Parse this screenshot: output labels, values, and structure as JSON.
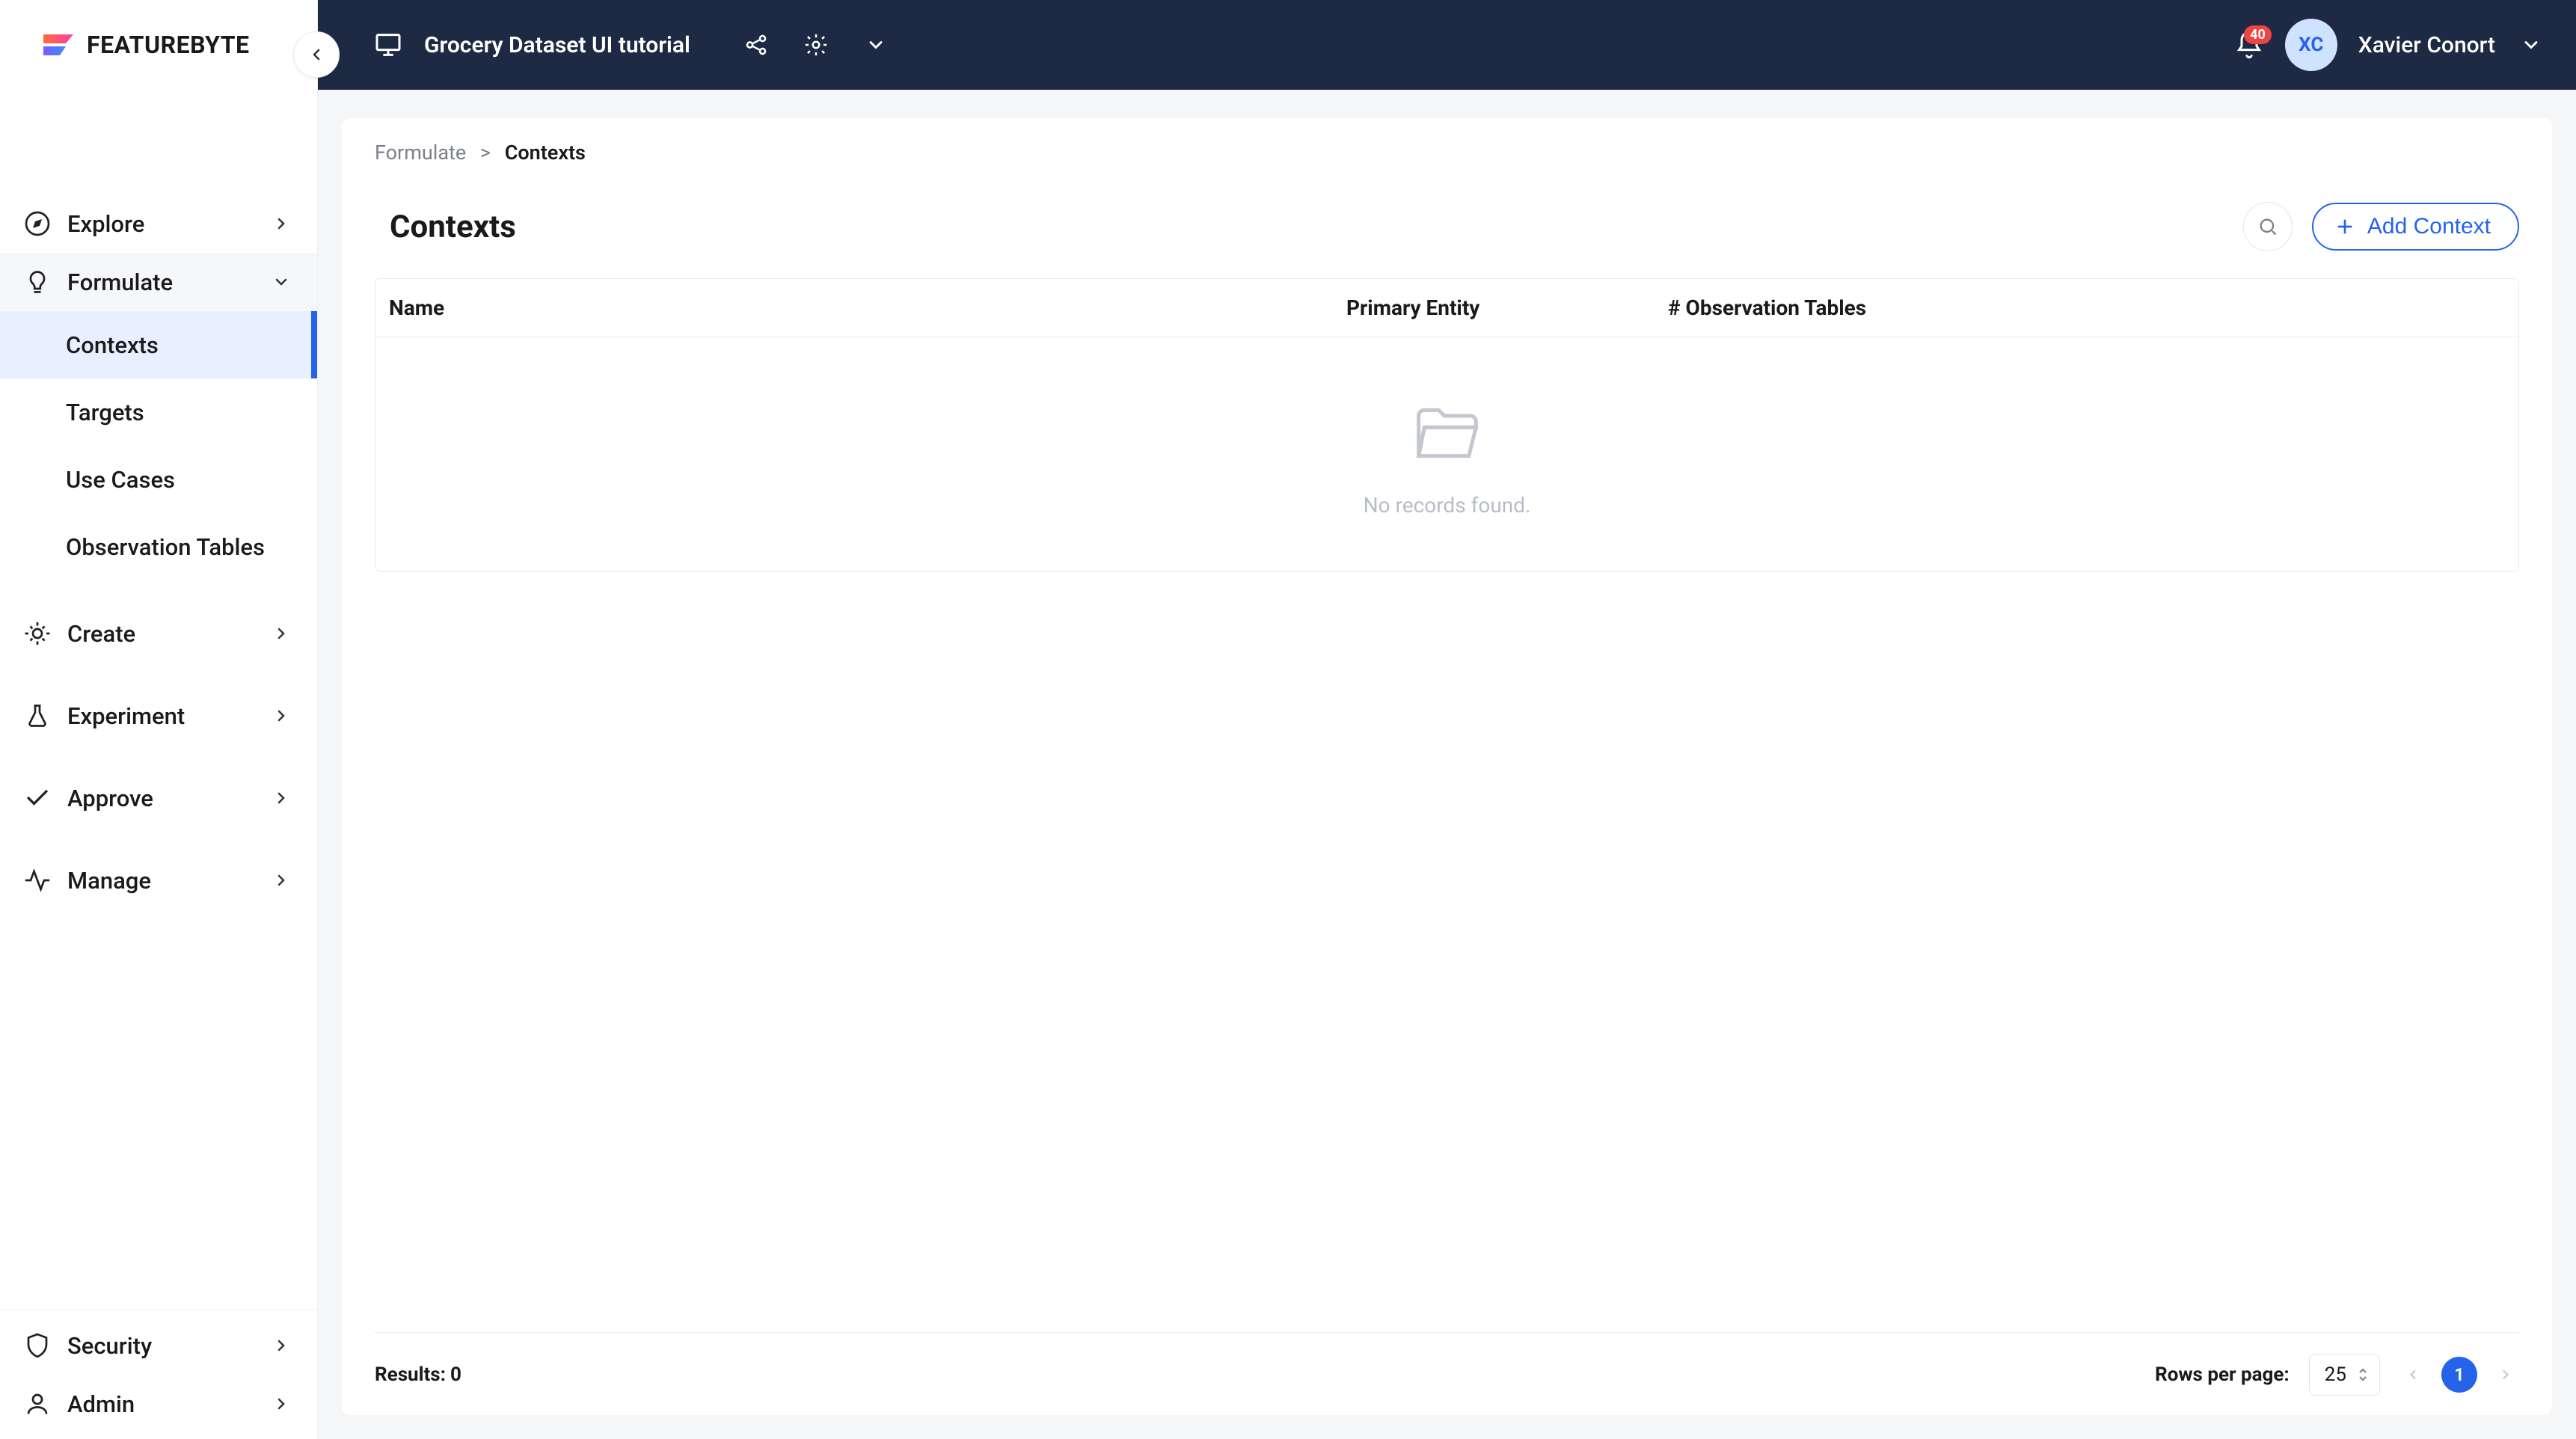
{
  "brand": "FEATUREBYTE",
  "header": {
    "project_name": "Grocery Dataset UI tutorial",
    "notification_count": "40",
    "user_initials": "XC",
    "user_name": "Xavier Conort"
  },
  "sidebar": {
    "items": [
      {
        "label": "Explore"
      },
      {
        "label": "Formulate",
        "expanded": true,
        "subitems": [
          {
            "label": "Contexts",
            "active": true
          },
          {
            "label": "Targets"
          },
          {
            "label": "Use Cases"
          },
          {
            "label": "Observation Tables"
          }
        ]
      },
      {
        "label": "Create"
      },
      {
        "label": "Experiment"
      },
      {
        "label": "Approve"
      },
      {
        "label": "Manage"
      }
    ],
    "bottom_items": [
      {
        "label": "Security"
      },
      {
        "label": "Admin"
      }
    ]
  },
  "breadcrumb": {
    "parent": "Formulate",
    "current": "Contexts"
  },
  "page": {
    "title": "Contexts",
    "add_button": "Add Context"
  },
  "table": {
    "columns": {
      "name": "Name",
      "entity": "Primary Entity",
      "obs": "# Observation Tables"
    },
    "empty_text": "No records found."
  },
  "footer": {
    "results_label": "Results:",
    "results_count": "0",
    "rows_label": "Rows per page:",
    "rows_value": "25",
    "current_page": "1"
  }
}
